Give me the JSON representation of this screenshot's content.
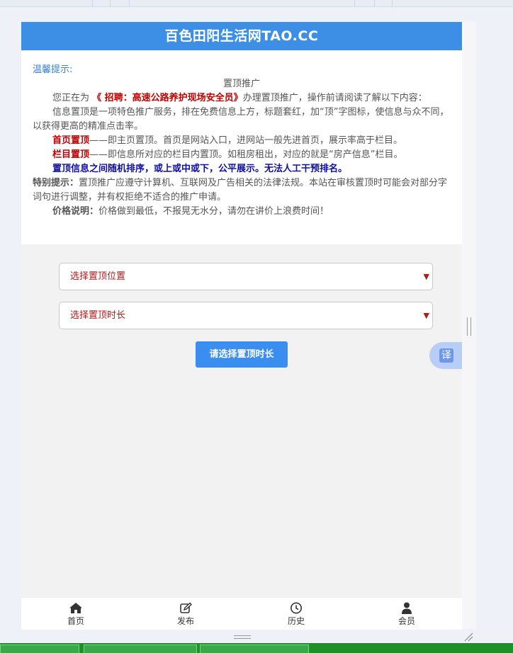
{
  "header": {
    "title": "百色田阳生活网TAO.CC"
  },
  "notice": {
    "tip_label": "温馨提示:",
    "heading": "置顶推广",
    "intro_before": "您正在为",
    "intro_title": "《 招聘：高速公路养护现场安全员》",
    "intro_after": "办理置顶推广，操作前请阅读了解以下内容：",
    "para_service": "信息置顶是一项特色推广服务，排在免费信息上方，标题套红，加“顶”字图标，使信息与众不同，以获得更高的精准点击率。",
    "home_top_label": "首页置顶",
    "home_top_text": "——即主页置顶。首页是网站入口，进网站一般先进首页，展示率高于栏目。",
    "column_top_label": "栏目置顶",
    "column_top_text": "——即信息所对应的栏目内置顶。如租房租出，对应的就是“房产信息”栏目。",
    "random_rule": "置顶信息之间随机排序，或上或中或下，公平展示。无法人工干预排名。",
    "special_label": "特别提示：",
    "special_text": "置顶推广应遵守计算机、互联网及广告相关的法律法规。本站在审核置顶时可能会对部分字词句进行调整，并有权拒绝不适合的推广申请。",
    "price_label": "价格说明：",
    "price_text": "价格做到最低，不报晃无水分，请勿在讲价上浪费时间！"
  },
  "form": {
    "position_select": "选择置顶位置",
    "duration_select": "选择置顶时长",
    "submit_label": "请选择置顶时长"
  },
  "translate": {
    "label": "译"
  },
  "bottom_nav": [
    {
      "label": "首页",
      "icon": "home-icon"
    },
    {
      "label": "发布",
      "icon": "edit-icon"
    },
    {
      "label": "历史",
      "icon": "clock-icon"
    },
    {
      "label": "会员",
      "icon": "user-icon"
    }
  ],
  "colors": {
    "header": "#3d8fe6",
    "accent_red": "#c00000",
    "accent_blue": "#1010a0",
    "button": "#3a8ef0"
  }
}
